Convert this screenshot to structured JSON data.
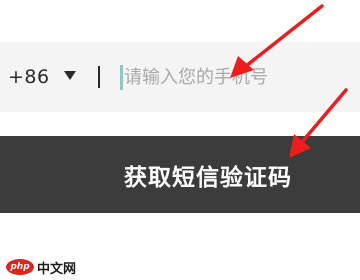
{
  "phone_form": {
    "country_code": "+86",
    "phone_placeholder": "请输入您的手机号",
    "phone_value": ""
  },
  "actions": {
    "get_code_label": "获取短信验证码"
  },
  "annotations": {
    "arrow_color": "#ee1c1c"
  },
  "watermark": {
    "badge_text": "php",
    "site_text": "中文网"
  },
  "colors": {
    "input_row_bg": "#f4f4f4",
    "button_bg": "#3c3c3c",
    "caret": "#8fc9c5"
  }
}
